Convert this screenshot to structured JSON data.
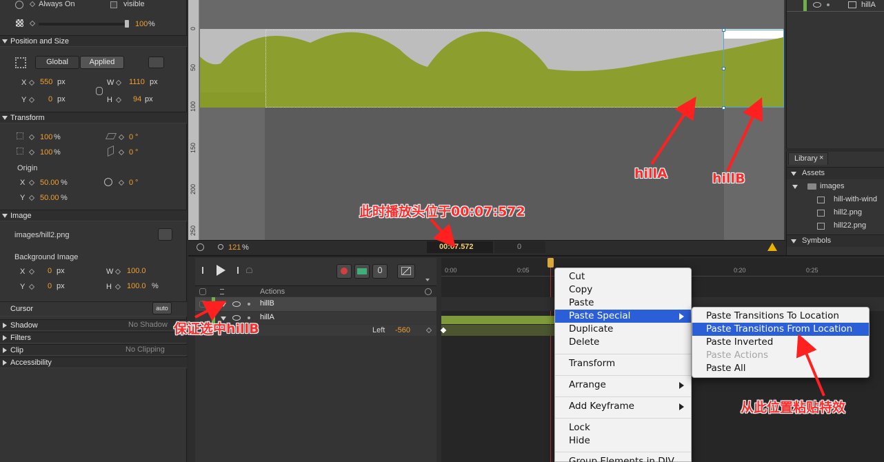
{
  "props": {
    "always_on": "Always On",
    "visible": "visible",
    "opacity": "100",
    "pct": "%",
    "position_size": "Position and Size",
    "global": "Global",
    "applied": "Applied",
    "x_label": "X",
    "y_label": "Y",
    "w_label": "W",
    "h_label": "H",
    "x_val": "550",
    "y_val": "0",
    "w_val": "1110",
    "h_val": "94",
    "px": "px",
    "transform": "Transform",
    "scale_x": "100",
    "scale_y": "100",
    "skew_x": "0",
    "skew_y": "0",
    "deg": "°",
    "origin": "Origin",
    "origin_x": "50.00",
    "origin_y": "50.00",
    "rotation": "0",
    "image": "Image",
    "image_path": "images/hill2.png",
    "background_image": "Background Image",
    "bg_x": "0",
    "bg_y": "0",
    "bg_w": "100.0",
    "bg_h": "100.0",
    "cursor": "Cursor",
    "auto": "auto",
    "shadow": "Shadow",
    "no_shadow": "No Shadow",
    "filters": "Filters",
    "clip": "Clip",
    "no_clipping": "No Clipping",
    "accessibility": "Accessibility"
  },
  "stage": {
    "ruler_labels": [
      "0",
      "50",
      "100",
      "150",
      "200",
      "250"
    ],
    "zoom": "121",
    "zoom_unit": "%",
    "time": "00:07.572",
    "frame": "0"
  },
  "right_top": {
    "element": "hillA"
  },
  "library": {
    "tab": "Library",
    "close": "×",
    "assets": "Assets",
    "images_folder": "images",
    "files": [
      "hill-with-wind",
      "hill2.png",
      "hill22.png"
    ],
    "symbols": "Symbols"
  },
  "timeline": {
    "actions": "Actions",
    "layers": [
      "hillB",
      "hillA"
    ],
    "prop_name": "Left",
    "prop_value": "-560",
    "ticks": [
      "0:00",
      "0:05",
      "0:20",
      "0:25"
    ]
  },
  "context_menu": {
    "items": [
      {
        "label": "Cut"
      },
      {
        "label": "Copy"
      },
      {
        "label": "Paste"
      },
      {
        "label": "Paste Special"
      },
      {
        "label": "Duplicate"
      },
      {
        "label": "Delete"
      },
      {
        "label": "Transform"
      },
      {
        "label": "Arrange"
      },
      {
        "label": "Add Keyframe"
      },
      {
        "label": "Lock"
      },
      {
        "label": "Hide"
      },
      {
        "label": "Group Elements in DIV"
      }
    ]
  },
  "submenu": {
    "items": [
      {
        "label": "Paste Transitions To Location"
      },
      {
        "label": "Paste Transitions From Location"
      },
      {
        "label": "Paste Inverted"
      },
      {
        "label": "Paste Actions"
      },
      {
        "label": "Paste All"
      }
    ]
  },
  "annotations": {
    "hillA": "hillA",
    "hillB": "hillB",
    "playhead_note": "此时播放头位于00:07:572",
    "ensure_hillB": "保证选中hillB",
    "paste_from_here": "从此位置粘贴特效"
  },
  "colors": {
    "hill_green": "#8c9e2e",
    "menu_highlight": "#2a5fd8",
    "value_orange": "#f0a030",
    "annotation_red": "#ff2a2a"
  }
}
